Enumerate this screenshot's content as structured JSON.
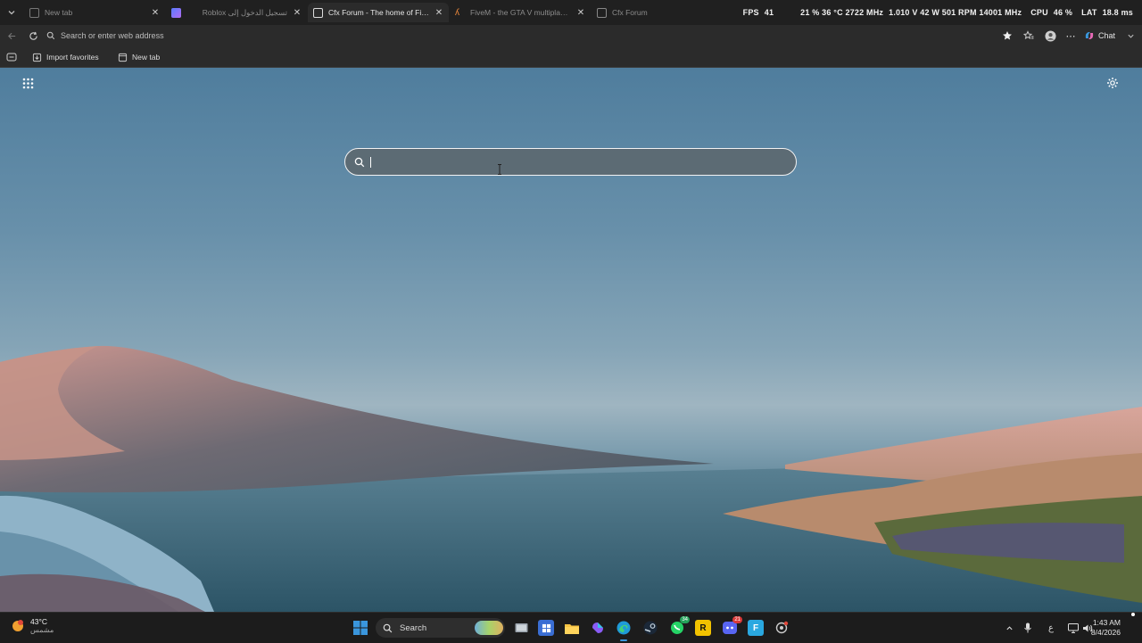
{
  "browser": {
    "tabs": [
      {
        "title": "New tab",
        "favicon": "new-tab-icon",
        "active": false
      },
      {
        "title": "",
        "favicon": "copilot-icon",
        "active": false
      },
      {
        "title": "Roblox تسجيل الدخول إلى",
        "favicon": "roblox-icon",
        "active": false
      },
      {
        "title": "Cfx Forum - The home of FiveM &",
        "favicon": "cfx-icon",
        "active": true
      },
      {
        "title": "FiveM - the GTA V multiplayer mo",
        "favicon": "fivem-icon",
        "active": false
      },
      {
        "title": "Cfx Forum",
        "favicon": "cfx-icon",
        "active": false
      }
    ],
    "address_placeholder": "Search or enter web address",
    "chat_label": "Chat",
    "favorites": [
      {
        "label": "Import favorites",
        "icon": "import-icon"
      },
      {
        "label": "New tab",
        "icon": "page-icon"
      }
    ]
  },
  "overlay": {
    "fps_label": "FPS",
    "fps_value": "41",
    "gpu_text": "21 % 36 °C 2722 MHz",
    "gpu_power": "1.010 V 42 W 501 RPM 14001 MHz",
    "cpu_label": "CPU",
    "cpu_value": "46 %",
    "lat_label": "LAT",
    "lat_value": "18.8 ms"
  },
  "newtab": {
    "search_value": "",
    "search_placeholder": ""
  },
  "taskbar": {
    "weather_temp": "43°C",
    "weather_desc": "مشمس",
    "search_label": "Search",
    "whatsapp_badge": "34",
    "discord_badge": "21",
    "lang": "ع",
    "time": "1:43 AM",
    "date": "8/4/2026"
  },
  "colors": {
    "accent": "#3a96dd",
    "sky_top": "#4f7d9d",
    "lake": "#3f6b80"
  }
}
